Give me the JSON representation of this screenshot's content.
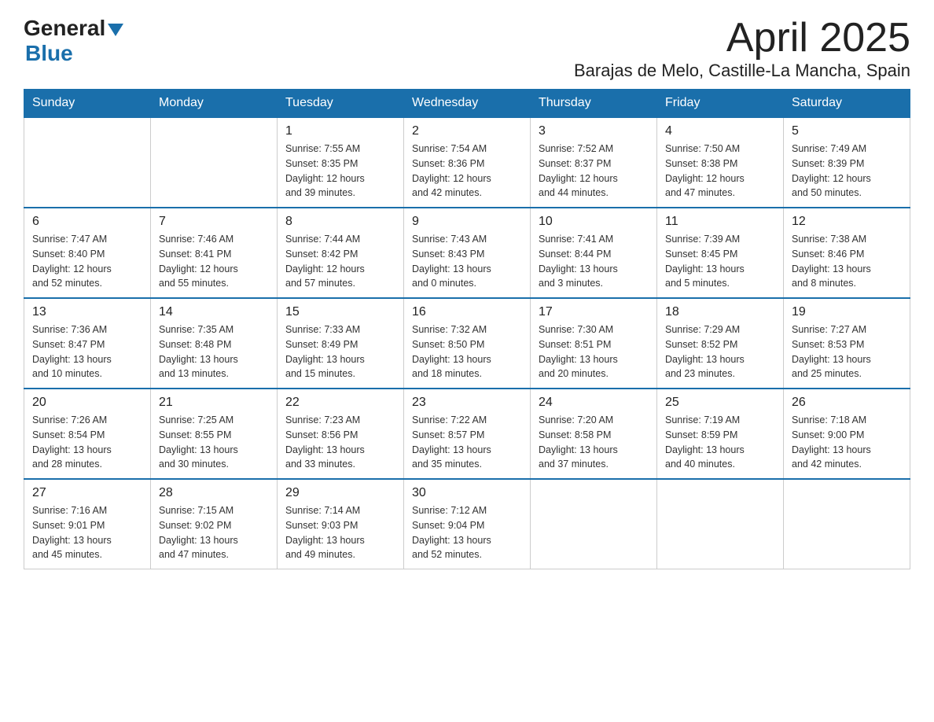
{
  "header": {
    "logo_general": "General",
    "logo_blue": "Blue",
    "month_title": "April 2025",
    "location": "Barajas de Melo, Castille-La Mancha, Spain"
  },
  "days_of_week": [
    "Sunday",
    "Monday",
    "Tuesday",
    "Wednesday",
    "Thursday",
    "Friday",
    "Saturday"
  ],
  "weeks": [
    [
      {
        "day": "",
        "info": ""
      },
      {
        "day": "",
        "info": ""
      },
      {
        "day": "1",
        "info": "Sunrise: 7:55 AM\nSunset: 8:35 PM\nDaylight: 12 hours\nand 39 minutes."
      },
      {
        "day": "2",
        "info": "Sunrise: 7:54 AM\nSunset: 8:36 PM\nDaylight: 12 hours\nand 42 minutes."
      },
      {
        "day": "3",
        "info": "Sunrise: 7:52 AM\nSunset: 8:37 PM\nDaylight: 12 hours\nand 44 minutes."
      },
      {
        "day": "4",
        "info": "Sunrise: 7:50 AM\nSunset: 8:38 PM\nDaylight: 12 hours\nand 47 minutes."
      },
      {
        "day": "5",
        "info": "Sunrise: 7:49 AM\nSunset: 8:39 PM\nDaylight: 12 hours\nand 50 minutes."
      }
    ],
    [
      {
        "day": "6",
        "info": "Sunrise: 7:47 AM\nSunset: 8:40 PM\nDaylight: 12 hours\nand 52 minutes."
      },
      {
        "day": "7",
        "info": "Sunrise: 7:46 AM\nSunset: 8:41 PM\nDaylight: 12 hours\nand 55 minutes."
      },
      {
        "day": "8",
        "info": "Sunrise: 7:44 AM\nSunset: 8:42 PM\nDaylight: 12 hours\nand 57 minutes."
      },
      {
        "day": "9",
        "info": "Sunrise: 7:43 AM\nSunset: 8:43 PM\nDaylight: 13 hours\nand 0 minutes."
      },
      {
        "day": "10",
        "info": "Sunrise: 7:41 AM\nSunset: 8:44 PM\nDaylight: 13 hours\nand 3 minutes."
      },
      {
        "day": "11",
        "info": "Sunrise: 7:39 AM\nSunset: 8:45 PM\nDaylight: 13 hours\nand 5 minutes."
      },
      {
        "day": "12",
        "info": "Sunrise: 7:38 AM\nSunset: 8:46 PM\nDaylight: 13 hours\nand 8 minutes."
      }
    ],
    [
      {
        "day": "13",
        "info": "Sunrise: 7:36 AM\nSunset: 8:47 PM\nDaylight: 13 hours\nand 10 minutes."
      },
      {
        "day": "14",
        "info": "Sunrise: 7:35 AM\nSunset: 8:48 PM\nDaylight: 13 hours\nand 13 minutes."
      },
      {
        "day": "15",
        "info": "Sunrise: 7:33 AM\nSunset: 8:49 PM\nDaylight: 13 hours\nand 15 minutes."
      },
      {
        "day": "16",
        "info": "Sunrise: 7:32 AM\nSunset: 8:50 PM\nDaylight: 13 hours\nand 18 minutes."
      },
      {
        "day": "17",
        "info": "Sunrise: 7:30 AM\nSunset: 8:51 PM\nDaylight: 13 hours\nand 20 minutes."
      },
      {
        "day": "18",
        "info": "Sunrise: 7:29 AM\nSunset: 8:52 PM\nDaylight: 13 hours\nand 23 minutes."
      },
      {
        "day": "19",
        "info": "Sunrise: 7:27 AM\nSunset: 8:53 PM\nDaylight: 13 hours\nand 25 minutes."
      }
    ],
    [
      {
        "day": "20",
        "info": "Sunrise: 7:26 AM\nSunset: 8:54 PM\nDaylight: 13 hours\nand 28 minutes."
      },
      {
        "day": "21",
        "info": "Sunrise: 7:25 AM\nSunset: 8:55 PM\nDaylight: 13 hours\nand 30 minutes."
      },
      {
        "day": "22",
        "info": "Sunrise: 7:23 AM\nSunset: 8:56 PM\nDaylight: 13 hours\nand 33 minutes."
      },
      {
        "day": "23",
        "info": "Sunrise: 7:22 AM\nSunset: 8:57 PM\nDaylight: 13 hours\nand 35 minutes."
      },
      {
        "day": "24",
        "info": "Sunrise: 7:20 AM\nSunset: 8:58 PM\nDaylight: 13 hours\nand 37 minutes."
      },
      {
        "day": "25",
        "info": "Sunrise: 7:19 AM\nSunset: 8:59 PM\nDaylight: 13 hours\nand 40 minutes."
      },
      {
        "day": "26",
        "info": "Sunrise: 7:18 AM\nSunset: 9:00 PM\nDaylight: 13 hours\nand 42 minutes."
      }
    ],
    [
      {
        "day": "27",
        "info": "Sunrise: 7:16 AM\nSunset: 9:01 PM\nDaylight: 13 hours\nand 45 minutes."
      },
      {
        "day": "28",
        "info": "Sunrise: 7:15 AM\nSunset: 9:02 PM\nDaylight: 13 hours\nand 47 minutes."
      },
      {
        "day": "29",
        "info": "Sunrise: 7:14 AM\nSunset: 9:03 PM\nDaylight: 13 hours\nand 49 minutes."
      },
      {
        "day": "30",
        "info": "Sunrise: 7:12 AM\nSunset: 9:04 PM\nDaylight: 13 hours\nand 52 minutes."
      },
      {
        "day": "",
        "info": ""
      },
      {
        "day": "",
        "info": ""
      },
      {
        "day": "",
        "info": ""
      }
    ]
  ]
}
